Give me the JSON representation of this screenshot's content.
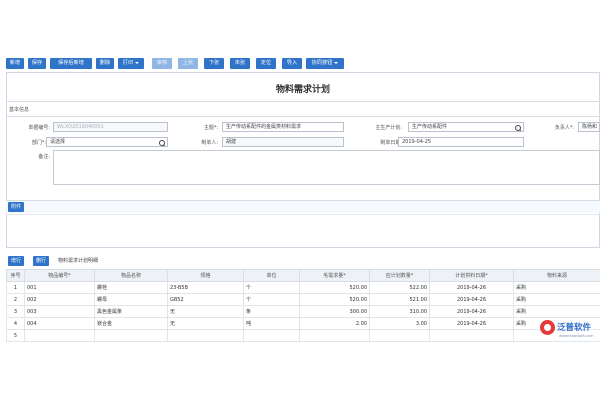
{
  "toolbar": {
    "buttons": [
      {
        "label": "新增"
      },
      {
        "label": "保存"
      },
      {
        "label": "保存后新增"
      },
      {
        "label": "删除"
      },
      {
        "label": "打印"
      },
      {
        "label": "审核"
      },
      {
        "label": "上张"
      },
      {
        "label": "下张"
      },
      {
        "label": "末张"
      },
      {
        "label": "定位"
      },
      {
        "label": "导入"
      },
      {
        "label": "协同按钮"
      }
    ]
  },
  "form": {
    "title": "物料需求计划",
    "section": "基本信息",
    "fields": {
      "doc_no": {
        "label": "单据编号:",
        "value": "WLXQ2019040001"
      },
      "subject": {
        "label": "主题*:",
        "value": "生产传动系配件的金属类材料需求"
      },
      "plan": {
        "label": "主生产计划:",
        "value": "生产传动系配件"
      },
      "owner": {
        "label": "负责人*:",
        "value": "陈杨和"
      },
      "dept": {
        "label": "部门*:",
        "value": "请选择"
      },
      "creator": {
        "label": "制单人:",
        "value": "胡建"
      },
      "date": {
        "label": "制单日期:",
        "value": "2019-04-25"
      },
      "remark": {
        "label": "备注:",
        "value": ""
      }
    },
    "attachment_button": "附件"
  },
  "detail": {
    "add_row": "增行",
    "del_row": "删行",
    "title": "物料需求计划明细",
    "columns": [
      "序号",
      "物品编号*",
      "物品名称",
      "规格",
      "单位",
      "毛需求量*",
      "应计划数量*",
      "计划供料日期*",
      "物料来源"
    ],
    "rows": [
      {
        "idx": "1",
        "code": "001",
        "name": "螺栓",
        "spec": "23-B5B",
        "unit": "个",
        "gross": "520.00",
        "plan": "522.00",
        "date": "2019-04-26",
        "source": "采购"
      },
      {
        "idx": "2",
        "code": "002",
        "name": "螺母",
        "spec": "GB52",
        "unit": "个",
        "gross": "520.00",
        "plan": "521.00",
        "date": "2019-04-26",
        "source": "采购"
      },
      {
        "idx": "3",
        "code": "003",
        "name": "黑色金属条",
        "spec": "无",
        "unit": "条",
        "gross": "300.00",
        "plan": "310.00",
        "date": "2019-04-26",
        "source": "采购"
      },
      {
        "idx": "4",
        "code": "004",
        "name": "镁合金",
        "spec": "无",
        "unit": "吨",
        "gross": "2.00",
        "plan": "3.00",
        "date": "2019-04-26",
        "source": "采购"
      },
      {
        "idx": "5",
        "code": "",
        "name": "",
        "spec": "",
        "unit": "",
        "gross": "",
        "plan": "",
        "date": "",
        "source": ""
      }
    ]
  },
  "watermark": {
    "brand": "泛普软件",
    "url": "www.fanpusoft.com"
  },
  "colors": {
    "primary": "#2f74c8",
    "primary_light": "#8fb6e4",
    "border": "#cfd8e3"
  }
}
